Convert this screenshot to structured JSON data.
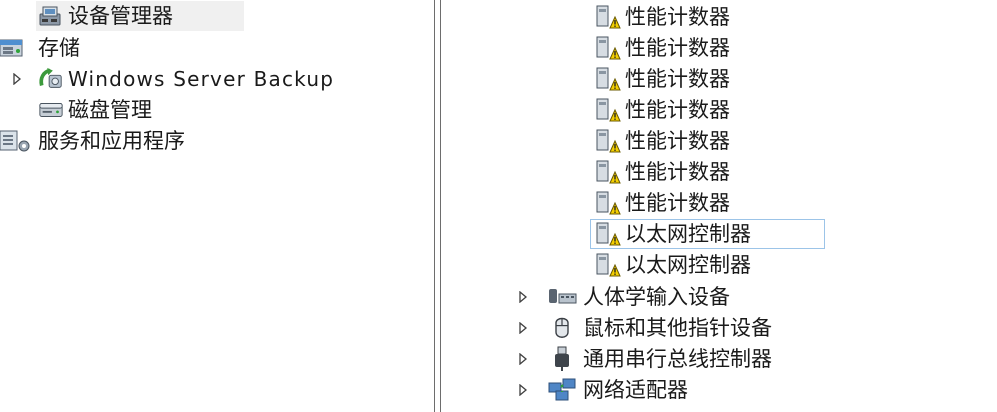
{
  "left_tree": {
    "device_manager": "设备管理器",
    "storage": "存储",
    "windows_server_backup": "Windows Server Backup",
    "disk_management": "磁盘管理",
    "services_apps": "服务和应用程序"
  },
  "right_tree": {
    "perf_counters": [
      "性能计数器",
      "性能计数器",
      "性能计数器",
      "性能计数器",
      "性能计数器",
      "性能计数器",
      "性能计数器"
    ],
    "ethernet_controllers": [
      "以太网控制器",
      "以太网控制器"
    ],
    "categories": [
      "人体学输入设备",
      "鼠标和其他指针设备",
      "通用串行总线控制器",
      "网络适配器"
    ]
  },
  "colors": {
    "selection_gray": "#f0f0f0",
    "focus_border": "#9cc4e8",
    "warning_yellow": "#f5d000"
  },
  "icons": {
    "unknown_device": "unknown-device-warning-icon",
    "device_manager": "device-manager-icon",
    "storage": "storage-icon",
    "backup": "windows-server-backup-icon",
    "disk": "disk-management-icon",
    "services": "services-applications-icon",
    "hid": "human-interface-device-icon",
    "mouse": "mouse-icon",
    "usb": "usb-controller-icon",
    "network": "network-adapter-icon"
  }
}
